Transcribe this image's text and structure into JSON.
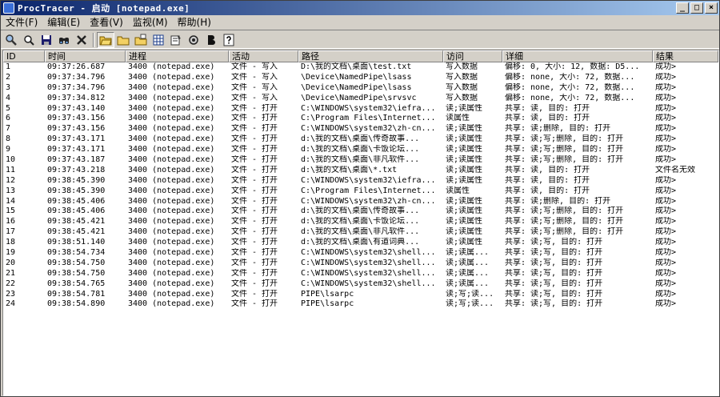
{
  "window": {
    "title": "ProcTracer - 启动 [notepad.exe]",
    "controls": [
      "_",
      "□",
      "×"
    ]
  },
  "menu": [
    "文件(F)",
    "编辑(E)",
    "查看(V)",
    "监视(M)",
    "帮助(H)"
  ],
  "columns": [
    "ID",
    "时间",
    "进程",
    "活动",
    "路径",
    "访问",
    "详细",
    "结果"
  ],
  "rows": [
    [
      "1",
      "09:37:26.687",
      "3400 (notepad.exe)",
      "文件 - 写入",
      "D:\\我的文档\\桌面\\test.txt",
      "写入数据",
      "偏移: 0, 大小: 12, 数据: D5...",
      "成功>"
    ],
    [
      "2",
      "09:37:34.796",
      "3400 (notepad.exe)",
      "文件 - 写入",
      "\\Device\\NamedPipe\\lsass",
      "写入数据",
      "偏移: none, 大小: 72, 数据...",
      "成功>"
    ],
    [
      "3",
      "09:37:34.796",
      "3400 (notepad.exe)",
      "文件 - 写入",
      "\\Device\\NamedPipe\\lsass",
      "写入数据",
      "偏移: none, 大小: 72, 数据...",
      "成功>"
    ],
    [
      "4",
      "09:37:34.812",
      "3400 (notepad.exe)",
      "文件 - 写入",
      "\\Device\\NamedPipe\\srvsvc",
      "写入数据",
      "偏移: none, 大小: 72, 数据...",
      "成功>"
    ],
    [
      "5",
      "09:37:43.140",
      "3400 (notepad.exe)",
      "文件 - 打开",
      "C:\\WINDOWS\\system32\\iefra...",
      "读;读属性",
      "共享: 读, 目的: 打开",
      "成功>"
    ],
    [
      "6",
      "09:37:43.156",
      "3400 (notepad.exe)",
      "文件 - 打开",
      "C:\\Program Files\\Internet...",
      "读属性",
      "共享: 读, 目的: 打开",
      "成功>"
    ],
    [
      "7",
      "09:37:43.156",
      "3400 (notepad.exe)",
      "文件 - 打开",
      "C:\\WINDOWS\\system32\\zh-cn...",
      "读;读属性",
      "共享: 读;删除, 目的: 打开",
      "成功>"
    ],
    [
      "8",
      "09:37:43.171",
      "3400 (notepad.exe)",
      "文件 - 打开",
      "d:\\我的文档\\桌面\\传奇故事...",
      "读;读属性",
      "共享: 读;写;删除, 目的: 打开",
      "成功>"
    ],
    [
      "9",
      "09:37:43.171",
      "3400 (notepad.exe)",
      "文件 - 打开",
      "d:\\我的文档\\桌面\\卡饭论坛...",
      "读;读属性",
      "共享: 读;写;删除, 目的: 打开",
      "成功>"
    ],
    [
      "10",
      "09:37:43.187",
      "3400 (notepad.exe)",
      "文件 - 打开",
      "d:\\我的文档\\桌面\\非凡软件...",
      "读;读属性",
      "共享: 读;写;删除, 目的: 打开",
      "成功>"
    ],
    [
      "11",
      "09:37:43.218",
      "3400 (notepad.exe)",
      "文件 - 打开",
      "d:\\我的文档\\桌面\\*.txt",
      "读;读属性",
      "共享: 读, 目的: 打开",
      "文件名无效"
    ],
    [
      "12",
      "09:38:45.390",
      "3400 (notepad.exe)",
      "文件 - 打开",
      "C:\\WINDOWS\\system32\\iefra...",
      "读;读属性",
      "共享: 读, 目的: 打开",
      "成功>"
    ],
    [
      "13",
      "09:38:45.390",
      "3400 (notepad.exe)",
      "文件 - 打开",
      "C:\\Program Files\\Internet...",
      "读属性",
      "共享: 读, 目的: 打开",
      "成功>"
    ],
    [
      "14",
      "09:38:45.406",
      "3400 (notepad.exe)",
      "文件 - 打开",
      "C:\\WINDOWS\\system32\\zh-cn...",
      "读;读属性",
      "共享: 读;删除, 目的: 打开",
      "成功>"
    ],
    [
      "15",
      "09:38:45.406",
      "3400 (notepad.exe)",
      "文件 - 打开",
      "d:\\我的文档\\桌面\\传奇故事...",
      "读;读属性",
      "共享: 读;写;删除, 目的: 打开",
      "成功>"
    ],
    [
      "16",
      "09:38:45.421",
      "3400 (notepad.exe)",
      "文件 - 打开",
      "d:\\我的文档\\桌面\\卡饭论坛...",
      "读;读属性",
      "共享: 读;写;删除, 目的: 打开",
      "成功>"
    ],
    [
      "17",
      "09:38:45.421",
      "3400 (notepad.exe)",
      "文件 - 打开",
      "d:\\我的文档\\桌面\\非凡软件...",
      "读;读属性",
      "共享: 读;写;删除, 目的: 打开",
      "成功>"
    ],
    [
      "18",
      "09:38:51.140",
      "3400 (notepad.exe)",
      "文件 - 打开",
      "d:\\我的文档\\桌面\\有道词典...",
      "读;读属性",
      "共享: 读;写, 目的: 打开",
      "成功>"
    ],
    [
      "19",
      "09:38:54.734",
      "3400 (notepad.exe)",
      "文件 - 打开",
      "C:\\WINDOWS\\system32\\shell...",
      "读;读属...",
      "共享: 读;写, 目的: 打开",
      "成功>"
    ],
    [
      "20",
      "09:38:54.750",
      "3400 (notepad.exe)",
      "文件 - 打开",
      "C:\\WINDOWS\\system32\\shell...",
      "读;读属...",
      "共享: 读;写, 目的: 打开",
      "成功>"
    ],
    [
      "21",
      "09:38:54.750",
      "3400 (notepad.exe)",
      "文件 - 打开",
      "C:\\WINDOWS\\system32\\shell...",
      "读;读属...",
      "共享: 读;写, 目的: 打开",
      "成功>"
    ],
    [
      "22",
      "09:38:54.765",
      "3400 (notepad.exe)",
      "文件 - 打开",
      "C:\\WINDOWS\\system32\\shell...",
      "读;读属...",
      "共享: 读;写, 目的: 打开",
      "成功>"
    ],
    [
      "23",
      "09:38:54.781",
      "3400 (notepad.exe)",
      "文件 - 打开",
      "PIPE\\lsarpc",
      "读;写;读...",
      "共享: 读;写, 目的: 打开",
      "成功>"
    ],
    [
      "24",
      "09:38:54.890",
      "3400 (notepad.exe)",
      "文件 - 打开",
      "PIPE\\lsarpc",
      "读;写;读...",
      "共享: 读;写, 目的: 打开",
      "成功>"
    ]
  ]
}
